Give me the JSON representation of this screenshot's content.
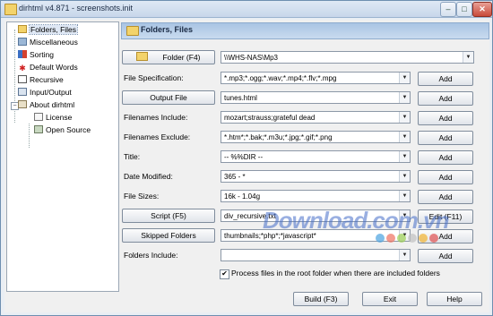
{
  "window": {
    "title": "dirhtml v4.871 - screenshots.init"
  },
  "window_controls": {
    "minimize": "–",
    "maximize": "□",
    "close": "✕"
  },
  "tree": {
    "items": [
      {
        "label": "Folders, Files"
      },
      {
        "label": "Miscellaneous"
      },
      {
        "label": "Sorting"
      },
      {
        "label": "Default Words"
      },
      {
        "label": "Recursive"
      },
      {
        "label": "Input/Output"
      },
      {
        "label": "About dirhtml"
      },
      {
        "label": "License"
      },
      {
        "label": "Open Source"
      }
    ],
    "expander": "−"
  },
  "panel": {
    "title": "Folders, Files"
  },
  "rows": {
    "folder": {
      "button": "Folder (F4)",
      "value": "\\\\WHS-NAS\\Mp3"
    },
    "file_spec": {
      "label": "File Specification:",
      "value": "*.mp3;*.ogg;*.wav;*.mp4;*.flv;*.mpg",
      "add": "Add"
    },
    "output_file": {
      "button": "Output File",
      "value": "tunes.html",
      "add": "Add"
    },
    "include": {
      "label": "Filenames Include:",
      "value": "mozart;strauss;grateful dead",
      "add": "Add"
    },
    "exclude": {
      "label": "Filenames Exclude:",
      "value": "*.htm*;*.bak;*.m3u;*.jpg;*.gif;*.png",
      "add": "Add"
    },
    "title": {
      "label": "Title:",
      "value": "-- %%DIR --",
      "add": "Add"
    },
    "date_modified": {
      "label": "Date Modified:",
      "value": "365 - *",
      "add": "Add"
    },
    "file_sizes": {
      "label": "File Sizes:",
      "value": "16k - 1.04g",
      "add": "Add"
    },
    "script": {
      "button": "Script (F5)",
      "value": "div_recursive.txt",
      "edit": "Edit (F11)"
    },
    "skipped": {
      "button": "Skipped Folders",
      "value": "thumbnails;*php*;*javascript*",
      "add": "Add"
    },
    "folders_include": {
      "label": "Folders Include:",
      "value": "",
      "add": "Add"
    }
  },
  "checkbox": {
    "checked_mark": "✔",
    "label": "Process files in the root folder when there are included folders"
  },
  "buttons": {
    "build": "Build (F3)",
    "exit": "Exit",
    "help": "Help"
  },
  "dropdown_arrow": "▼",
  "watermark": {
    "text": "Download.com.vn",
    "dot_colors": [
      "#4aa3df",
      "#f07060",
      "#9bcf53",
      "#c0c0c0",
      "#f2b330",
      "#e05050"
    ]
  },
  "colors": {
    "accent": "#8eabcd",
    "selection": "#dfe8f5"
  }
}
